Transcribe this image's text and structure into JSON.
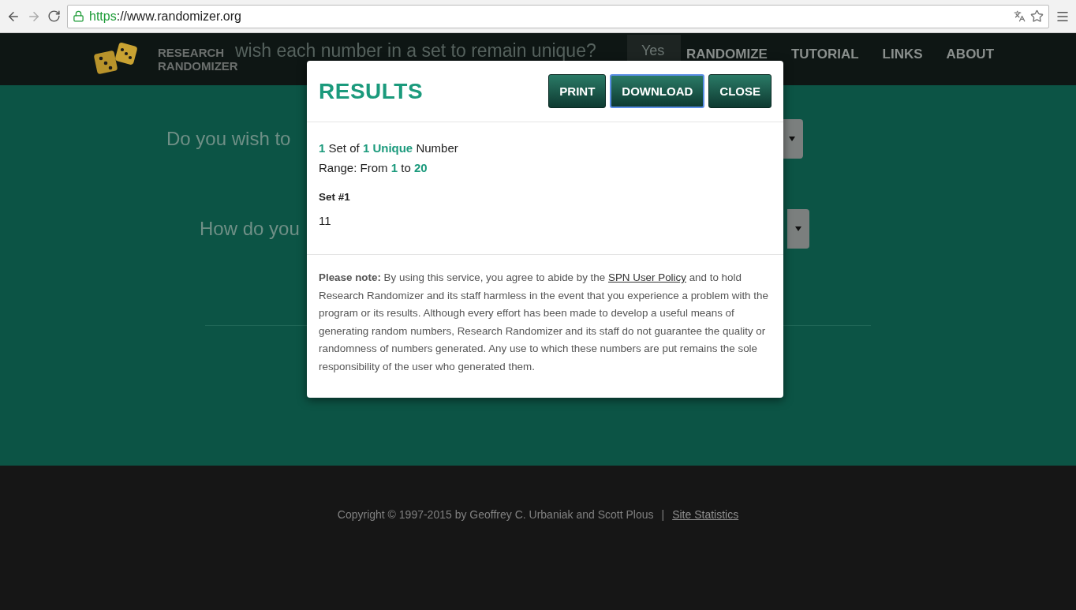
{
  "browser": {
    "url_scheme": "https",
    "url_rest": "://www.randomizer.org"
  },
  "header": {
    "brand": [
      "RESEARCH",
      "RANDOMIZER"
    ],
    "background_question": "wish each number in a set to remain unique?",
    "background_answer": "Yes",
    "nav": [
      {
        "label": "RANDOMIZE",
        "selected": false
      },
      {
        "label": "TUTORIAL",
        "selected": false
      },
      {
        "label": "LINKS",
        "selected": false
      },
      {
        "label": "ABOUT",
        "selected": false
      }
    ]
  },
  "form": {
    "questions": [
      {
        "text": "Do you wish to"
      },
      {
        "text": "How do you"
      }
    ]
  },
  "modal": {
    "title": "RESULTS",
    "buttons": [
      {
        "label": "PRINT",
        "focused": false
      },
      {
        "label": "DOWNLOAD",
        "focused": true
      },
      {
        "label": "CLOSE",
        "focused": false
      }
    ],
    "summary": [
      "**1** Set of **1 Unique** Number",
      "Range: From **1** to **20**"
    ],
    "set_label": "Set #1",
    "numbers": "11",
    "note": {
      "before": "**Please note:** By using this service, you agree to abide by the ",
      "link": "SPN User Policy",
      "after": " and to hold Research Randomizer and its staff harmless in the event that you experience a problem with the program or its results. Although every effort has been made to develop a useful means of generating random numbers, Research Randomizer and its staff do not guarantee the quality or randomness of numbers generated. Any use to which these numbers are put remains the sole responsibility of the user who generated them."
    }
  },
  "footer": {
    "copyright": "Copyright © 1997-2015 by Geoffrey C. Urbaniak and Scott Plous",
    "separator": "|",
    "link": "Site Statistics"
  }
}
